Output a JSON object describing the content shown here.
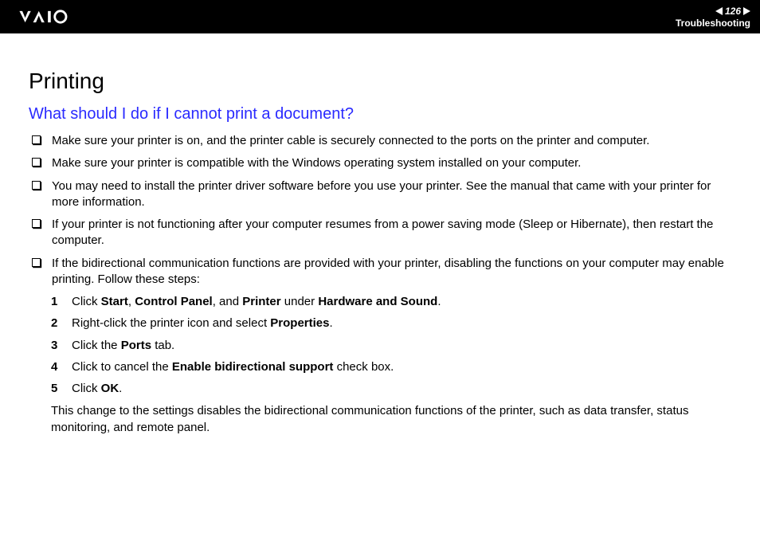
{
  "header": {
    "page_number": "126",
    "section": "Troubleshooting"
  },
  "main": {
    "heading": "Printing",
    "subheading": "What should I do if I cannot print a document?",
    "bullets": [
      "Make sure your printer is on, and the printer cable is securely connected to the ports on the printer and computer.",
      "Make sure your printer is compatible with the Windows operating system installed on your computer.",
      "You may need to install the printer driver software before you use your printer. See the manual that came with your printer for more information.",
      "If your printer is not functioning after your computer resumes from a power saving mode (Sleep or Hibernate), then restart the computer.",
      "If the bidirectional communication functions are provided with your printer, disabling the functions on your computer may enable printing. Follow these steps:"
    ],
    "steps": [
      {
        "n": "1",
        "pre": "Click ",
        "b1": "Start",
        "m1": ", ",
        "b2": "Control Panel",
        "m2": ", and ",
        "b3": "Printer",
        "m3": " under ",
        "b4": "Hardware and Sound",
        "post": "."
      },
      {
        "n": "2",
        "pre": "Right-click the printer icon and select ",
        "b1": "Properties",
        "post": "."
      },
      {
        "n": "3",
        "pre": "Click the ",
        "b1": "Ports",
        "post": " tab."
      },
      {
        "n": "4",
        "pre": "Click to cancel the ",
        "b1": "Enable bidirectional support",
        "post": " check box."
      },
      {
        "n": "5",
        "pre": "Click ",
        "b1": "OK",
        "post": "."
      }
    ],
    "closing": "This change to the settings disables the bidirectional communication functions of the printer, such as data transfer, status monitoring, and remote panel."
  }
}
